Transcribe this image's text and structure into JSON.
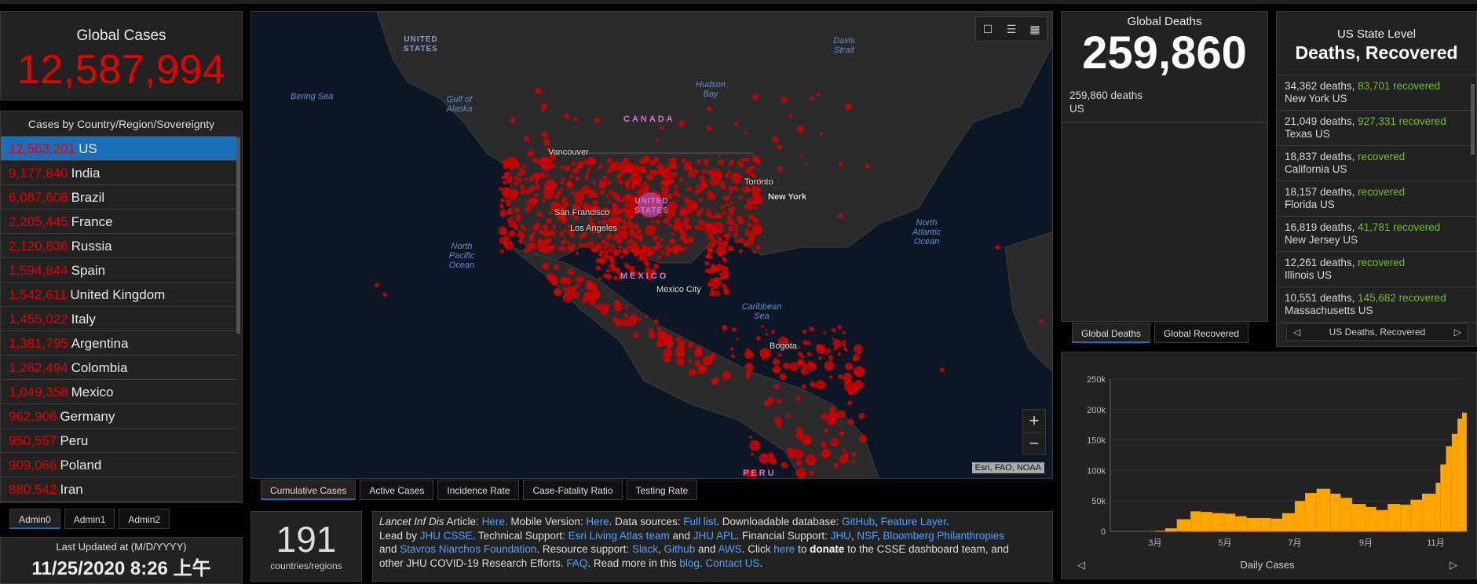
{
  "global_cases": {
    "label": "Global Cases",
    "value": "12,587,994"
  },
  "country_list": {
    "header": "Cases by Country/Region/Sovereignty",
    "rows": [
      {
        "value": "12,563,201",
        "name": "US"
      },
      {
        "value": "9,177,840",
        "name": "India"
      },
      {
        "value": "6,087,608",
        "name": "Brazil"
      },
      {
        "value": "2,205,445",
        "name": "France"
      },
      {
        "value": "2,120,836",
        "name": "Russia"
      },
      {
        "value": "1,594,844",
        "name": "Spain"
      },
      {
        "value": "1,542,611",
        "name": "United Kingdom"
      },
      {
        "value": "1,455,022",
        "name": "Italy"
      },
      {
        "value": "1,381,795",
        "name": "Argentina"
      },
      {
        "value": "1,262,494",
        "name": "Colombia"
      },
      {
        "value": "1,049,358",
        "name": "Mexico"
      },
      {
        "value": "962,906",
        "name": "Germany"
      },
      {
        "value": "950,557",
        "name": "Peru"
      },
      {
        "value": "909,066",
        "name": "Poland"
      },
      {
        "value": "880,542",
        "name": "Iran"
      }
    ]
  },
  "admin_tabs": [
    "Admin0",
    "Admin1",
    "Admin2"
  ],
  "last_updated": {
    "label": "Last Updated at (M/D/YYYY)",
    "value": "11/25/2020 8:26 上午"
  },
  "map": {
    "ocean_labels": [
      "Bering Sea",
      "Gulf of Alaska",
      "Hudson Bay",
      "Davis Strait",
      "North Pacific Ocean",
      "North Atlantic Ocean",
      "Caribbean Sea"
    ],
    "country_labels": [
      "UNITED STATES",
      "CANADA",
      "UNITED STATES",
      "MEXICO",
      "PERU"
    ],
    "city_labels": [
      "Vancouver",
      "Toronto",
      "New York",
      "San Francisco",
      "Los Angeles",
      "Mexico City",
      "Bogota"
    ],
    "attribution": "Esri, FAO, NOAA"
  },
  "map_tabs": [
    "Cumulative Cases",
    "Active Cases",
    "Incidence Rate",
    "Case-Fatality Ratio",
    "Testing Rate"
  ],
  "countries_count": {
    "value": "191",
    "label": "countries/regions"
  },
  "info": {
    "journal": "Lancet Inf Dis",
    "t1": " Article: ",
    "l1": "Here",
    "t2": ". Mobile Version: ",
    "l2": "Here",
    "t3": ". Data sources: ",
    "l3": "Full list",
    "t4": ". Downloadable database: ",
    "l4": "GitHub",
    "t5": ", ",
    "l5": "Feature Layer",
    "t6": ".",
    "t7": "Lead by ",
    "l6": "JHU CSSE",
    "t8": ". Technical Support: ",
    "l7": "Esri Living Atlas team",
    "t9": " and ",
    "l8": "JHU APL",
    "t10": ". Financial Support: ",
    "l9": "JHU",
    "t11": ", ",
    "l10": "NSF",
    "t12": ", ",
    "l11": "Bloomberg Philanthropies",
    "t13": "and ",
    "l12": "Stavros Niarchos Foundation",
    "t14": ". Resource support: ",
    "l13": "Slack",
    "t15": ", ",
    "l14": "Github",
    "t16": " and ",
    "l15": "AWS",
    "t17": ". Click ",
    "l16": "here",
    "t18": " to ",
    "b1": "donate",
    "t19": " to the CSSE dashboard team, and",
    "t20": "other JHU COVID-19 Research Efforts. ",
    "l17": "FAQ",
    "t21": ". Read more in this ",
    "l18": "blog",
    "t22": ". ",
    "l19": "Contact US",
    "t23": "."
  },
  "global_deaths": {
    "label": "Global Deaths",
    "value": "259,860",
    "row_value": "259,860 deaths",
    "row_place": "US"
  },
  "deaths_tabs": [
    "Global Deaths",
    "Global Recovered"
  ],
  "us_state": {
    "label": "US State Level",
    "title": "Deaths, Recovered",
    "rows": [
      {
        "deaths": "34,362 deaths,",
        "recovered": "83,701",
        "rec_label": "recovered",
        "state": "New York US"
      },
      {
        "deaths": "21,049 deaths,",
        "recovered": "927,331",
        "rec_label": "recovered",
        "state": "Texas US"
      },
      {
        "deaths": "18,837 deaths,",
        "recovered": "",
        "rec_label": "recovered",
        "state": "California US"
      },
      {
        "deaths": "18,157 deaths,",
        "recovered": "",
        "rec_label": "recovered",
        "state": "Florida US"
      },
      {
        "deaths": "16,819 deaths,",
        "recovered": "41,781",
        "rec_label": "recovered",
        "state": "New Jersey US"
      },
      {
        "deaths": "12,261 deaths,",
        "recovered": "",
        "rec_label": "recovered",
        "state": "Illinois US"
      },
      {
        "deaths": "10,551 deaths,",
        "recovered": "145,682",
        "rec_label": "recovered",
        "state": "Massachusetts US"
      }
    ],
    "nav_label": "US Deaths, Recovered"
  },
  "daily_nav_label": "Daily Cases",
  "colors": {
    "cases_red": "#e60000",
    "accent_blue": "#1b6fb8",
    "recovered_green": "#70c020",
    "bar_orange": "#ffa500",
    "link_blue": "#4aa3ff"
  },
  "chart_data": {
    "type": "bar",
    "xlabel": "Daily Cases",
    "ylabel": "",
    "ylim": [
      0,
      250000
    ],
    "y_ticks": [
      "0",
      "50k",
      "100k",
      "150k",
      "200k",
      "250k"
    ],
    "x_ticks": [
      "3月",
      "5月",
      "7月",
      "9月",
      "11月"
    ],
    "x": [
      "2020-01-22",
      "2020-02-01",
      "2020-02-15",
      "2020-03-01",
      "2020-03-10",
      "2020-03-20",
      "2020-04-01",
      "2020-04-10",
      "2020-04-20",
      "2020-05-01",
      "2020-05-10",
      "2020-05-20",
      "2020-06-01",
      "2020-06-10",
      "2020-06-20",
      "2020-07-01",
      "2020-07-10",
      "2020-07-20",
      "2020-08-01",
      "2020-08-10",
      "2020-08-20",
      "2020-09-01",
      "2020-09-10",
      "2020-09-20",
      "2020-10-01",
      "2020-10-10",
      "2020-10-20",
      "2020-11-01",
      "2020-11-05",
      "2020-11-10",
      "2020-11-15",
      "2020-11-20",
      "2020-11-24"
    ],
    "values": [
      0,
      0,
      0,
      1000,
      5000,
      20000,
      33000,
      32000,
      30000,
      29000,
      25000,
      22000,
      22000,
      21000,
      30000,
      50000,
      63000,
      70000,
      62000,
      55000,
      45000,
      40000,
      35000,
      45000,
      44000,
      52000,
      62000,
      80000,
      110000,
      140000,
      160000,
      185000,
      195000
    ]
  }
}
